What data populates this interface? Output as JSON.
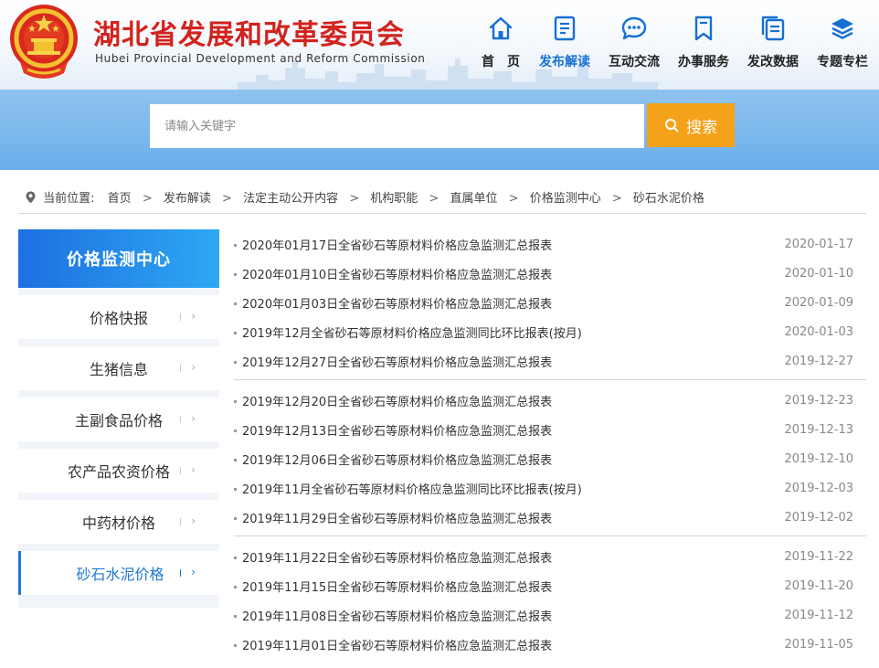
{
  "header": {
    "title": "湖北省发展和改革委员会",
    "subtitle": "Hubei Provincial Development and Reform Commission",
    "accent": "#d2231e"
  },
  "nav": {
    "items": [
      {
        "label": "首　页",
        "icon": "home-icon"
      },
      {
        "label": "发布解读",
        "icon": "document-icon",
        "active": true
      },
      {
        "label": "互动交流",
        "icon": "chat-icon"
      },
      {
        "label": "办事服务",
        "icon": "bookmark-icon"
      },
      {
        "label": "发改数据",
        "icon": "data-icon"
      },
      {
        "label": "专题专栏",
        "icon": "layers-icon"
      }
    ],
    "active_color": "#1670d2"
  },
  "search": {
    "placeholder": "请输入关键字",
    "button_label": "搜索",
    "button_color": "#f5a21b"
  },
  "breadcrumb": {
    "prefix": "当前位置:",
    "items": [
      "首页",
      "发布解读",
      "法定主动公开内容",
      "机构职能",
      "直属单位",
      "价格监测中心",
      "砂石水泥价格"
    ],
    "separator": ">"
  },
  "sidebar": {
    "title": "价格监测中心",
    "items": [
      {
        "label": "价格快报"
      },
      {
        "label": "生猪信息"
      },
      {
        "label": "主副食品价格"
      },
      {
        "label": "农产品农资价格"
      },
      {
        "label": "中药材价格"
      },
      {
        "label": "砂石水泥价格",
        "active": true
      }
    ],
    "chevron": "›"
  },
  "list": {
    "groups": [
      [
        {
          "title": "2020年01月17日全省砂石等原材料价格应急监测汇总报表",
          "date": "2020-01-17"
        },
        {
          "title": "2020年01月10日全省砂石等原材料价格应急监测汇总报表",
          "date": "2020-01-10"
        },
        {
          "title": "2020年01月03日全省砂石等原材料价格应急监测汇总报表",
          "date": "2020-01-09"
        },
        {
          "title": "2019年12月全省砂石等原材料价格应急监测同比环比报表(按月)",
          "date": "2020-01-03"
        },
        {
          "title": "2019年12月27日全省砂石等原材料价格应急监测汇总报表",
          "date": "2019-12-27"
        }
      ],
      [
        {
          "title": "2019年12月20日全省砂石等原材料价格应急监测汇总报表",
          "date": "2019-12-23"
        },
        {
          "title": "2019年12月13日全省砂石等原材料价格应急监测汇总报表",
          "date": "2019-12-13"
        },
        {
          "title": "2019年12月06日全省砂石等原材料价格应急监测汇总报表",
          "date": "2019-12-10"
        },
        {
          "title": "2019年11月全省砂石等原材料价格应急监测同比环比报表(按月)",
          "date": "2019-12-03"
        },
        {
          "title": "2019年11月29日全省砂石等原材料价格应急监测汇总报表",
          "date": "2019-12-02"
        }
      ],
      [
        {
          "title": "2019年11月22日全省砂石等原材料价格应急监测汇总报表",
          "date": "2019-11-22"
        },
        {
          "title": "2019年11月15日全省砂石等原材料价格应急监测汇总报表",
          "date": "2019-11-20"
        },
        {
          "title": "2019年11月08日全省砂石等原材料价格应急监测汇总报表",
          "date": "2019-11-12"
        },
        {
          "title": "2019年11月01日全省砂石等原材料价格应急监测汇总报表",
          "date": "2019-11-05"
        }
      ]
    ]
  }
}
